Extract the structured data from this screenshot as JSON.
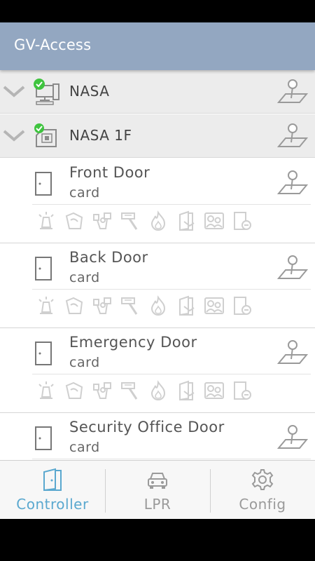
{
  "app": {
    "title": "GV-Access"
  },
  "groups": [
    {
      "label": "NASA",
      "status": "online",
      "device_icon": "computer-icon"
    },
    {
      "label": "NASA 1F",
      "status": "online",
      "device_icon": "controller-device-icon"
    }
  ],
  "doors": [
    {
      "name": "Front Door",
      "subtitle": "card"
    },
    {
      "name": "Back Door",
      "subtitle": "card"
    },
    {
      "name": "Emergency Door",
      "subtitle": "card"
    },
    {
      "name": "Security Office Door",
      "subtitle": "card"
    }
  ],
  "door_actions": [
    "alarm-icon",
    "unlock-hand-icon",
    "hands-up-icon",
    "hammer-icon",
    "fire-icon",
    "door-open-icon",
    "user-group-icon",
    "door-remove-icon"
  ],
  "tabs": [
    {
      "label": "Controller",
      "icon": "door-icon",
      "active": true
    },
    {
      "label": "LPR",
      "icon": "car-icon",
      "active": false
    },
    {
      "label": "Config",
      "icon": "gear-icon",
      "active": false
    }
  ],
  "colors": {
    "appbar": "#93a7c1",
    "active_tab": "#5aa8cf",
    "inactive_tab": "#9a9a9a",
    "status_ok": "#3fc43f"
  }
}
